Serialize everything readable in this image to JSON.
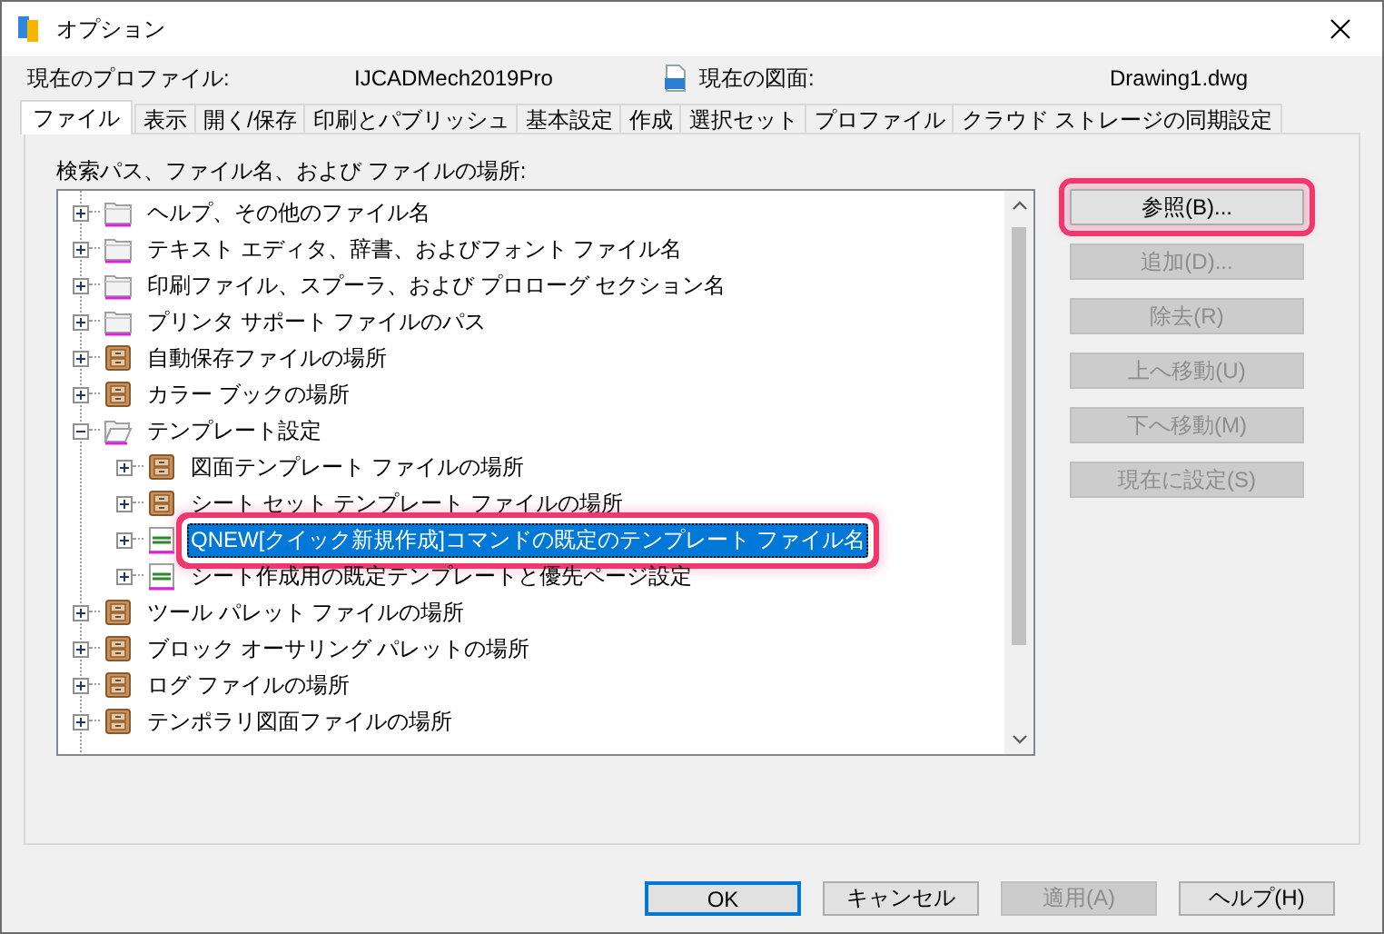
{
  "window": {
    "title": "オプション"
  },
  "profile": {
    "label": "現在のプロファイル:",
    "value": "IJCADMech2019Pro"
  },
  "drawing": {
    "label": "現在の図面:",
    "value": "Drawing1.dwg"
  },
  "tabs": [
    {
      "label": "ファイル",
      "selected": true
    },
    {
      "label": "表示",
      "selected": false
    },
    {
      "label": "開く/保存",
      "selected": false
    },
    {
      "label": "印刷とパブリッシュ",
      "selected": false
    },
    {
      "label": "基本設定",
      "selected": false
    },
    {
      "label": "作成",
      "selected": false
    },
    {
      "label": "選択セット",
      "selected": false
    },
    {
      "label": "プロファイル",
      "selected": false
    },
    {
      "label": "クラウド ストレージの同期設定",
      "selected": false
    }
  ],
  "tree": {
    "label": "検索パス、ファイル名、および ファイルの場所:",
    "items": [
      {
        "label": "ヘルプ、その他のファイル名",
        "kind": "folder",
        "expanded": false,
        "selected": false,
        "annotated": false
      },
      {
        "label": "テキスト エディタ、辞書、およびフォント ファイル名",
        "kind": "folder",
        "expanded": false,
        "selected": false,
        "annotated": false
      },
      {
        "label": "印刷ファイル、スプーラ、および プロローグ セクション名",
        "kind": "folder",
        "expanded": false,
        "selected": false,
        "annotated": false
      },
      {
        "label": "プリンタ サポート ファイルのパス",
        "kind": "folder",
        "expanded": false,
        "selected": false,
        "annotated": false
      },
      {
        "label": "自動保存ファイルの場所",
        "kind": "cabinet",
        "expanded": false,
        "selected": false,
        "annotated": false
      },
      {
        "label": "カラー ブックの場所",
        "kind": "cabinet",
        "expanded": false,
        "selected": false,
        "annotated": false
      },
      {
        "label": "テンプレート設定",
        "kind": "folder",
        "expanded": true,
        "selected": false,
        "annotated": false,
        "children": [
          {
            "label": "図面テンプレート ファイルの場所",
            "kind": "cabinet",
            "expanded": false,
            "selected": false,
            "annotated": false
          },
          {
            "label": "シート セット テンプレート ファイルの場所",
            "kind": "cabinet",
            "expanded": false,
            "selected": false,
            "annotated": false
          },
          {
            "label": "QNEW[クイック新規作成]コマンドの既定のテンプレート ファイル名",
            "kind": "template",
            "expanded": false,
            "selected": true,
            "annotated": true
          },
          {
            "label": "シート作成用の既定テンプレートと優先ページ設定",
            "kind": "template",
            "expanded": false,
            "selected": false,
            "annotated": false
          }
        ]
      },
      {
        "label": "ツール パレット ファイルの場所",
        "kind": "cabinet",
        "expanded": false,
        "selected": false,
        "annotated": false
      },
      {
        "label": "ブロック オーサリング パレットの場所",
        "kind": "cabinet",
        "expanded": false,
        "selected": false,
        "annotated": false
      },
      {
        "label": "ログ ファイルの場所",
        "kind": "cabinet",
        "expanded": false,
        "selected": false,
        "annotated": false
      },
      {
        "label": "テンポラリ図面ファイルの場所",
        "kind": "cabinet",
        "expanded": false,
        "selected": false,
        "annotated": false
      }
    ]
  },
  "side_buttons": [
    {
      "label": "参照(B)...",
      "disabled": false,
      "annotated": true
    },
    {
      "label": "追加(D)...",
      "disabled": true,
      "annotated": false
    },
    {
      "label": "除去(R)",
      "disabled": true,
      "annotated": false
    },
    {
      "label": "上へ移動(U)",
      "disabled": true,
      "annotated": false
    },
    {
      "label": "下へ移動(M)",
      "disabled": true,
      "annotated": false
    },
    {
      "label": "現在に設定(S)",
      "disabled": true,
      "annotated": false
    }
  ],
  "buttons": [
    {
      "label": "OK",
      "disabled": false,
      "default": true
    },
    {
      "label": "キャンセル",
      "disabled": false,
      "default": false
    },
    {
      "label": "適用(A)",
      "disabled": true,
      "default": false
    },
    {
      "label": "ヘルプ(H)",
      "disabled": false,
      "default": false
    }
  ]
}
